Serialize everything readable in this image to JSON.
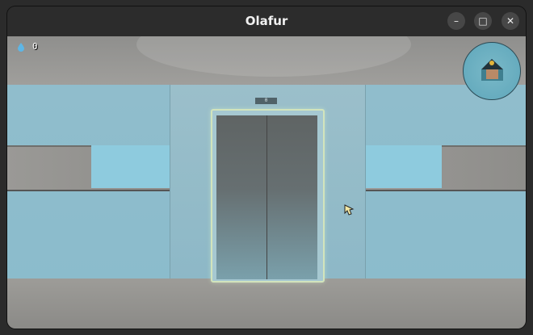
{
  "window": {
    "title": "Olafur"
  },
  "hud": {
    "counter": "0",
    "counter_icon": "water-drop-icon"
  },
  "elevator": {
    "floor_indicator": "0"
  },
  "colors": {
    "wall_blue": "#8ebdcc",
    "window_blue": "#8ecbde",
    "door_glow": "#d2e4bc"
  }
}
